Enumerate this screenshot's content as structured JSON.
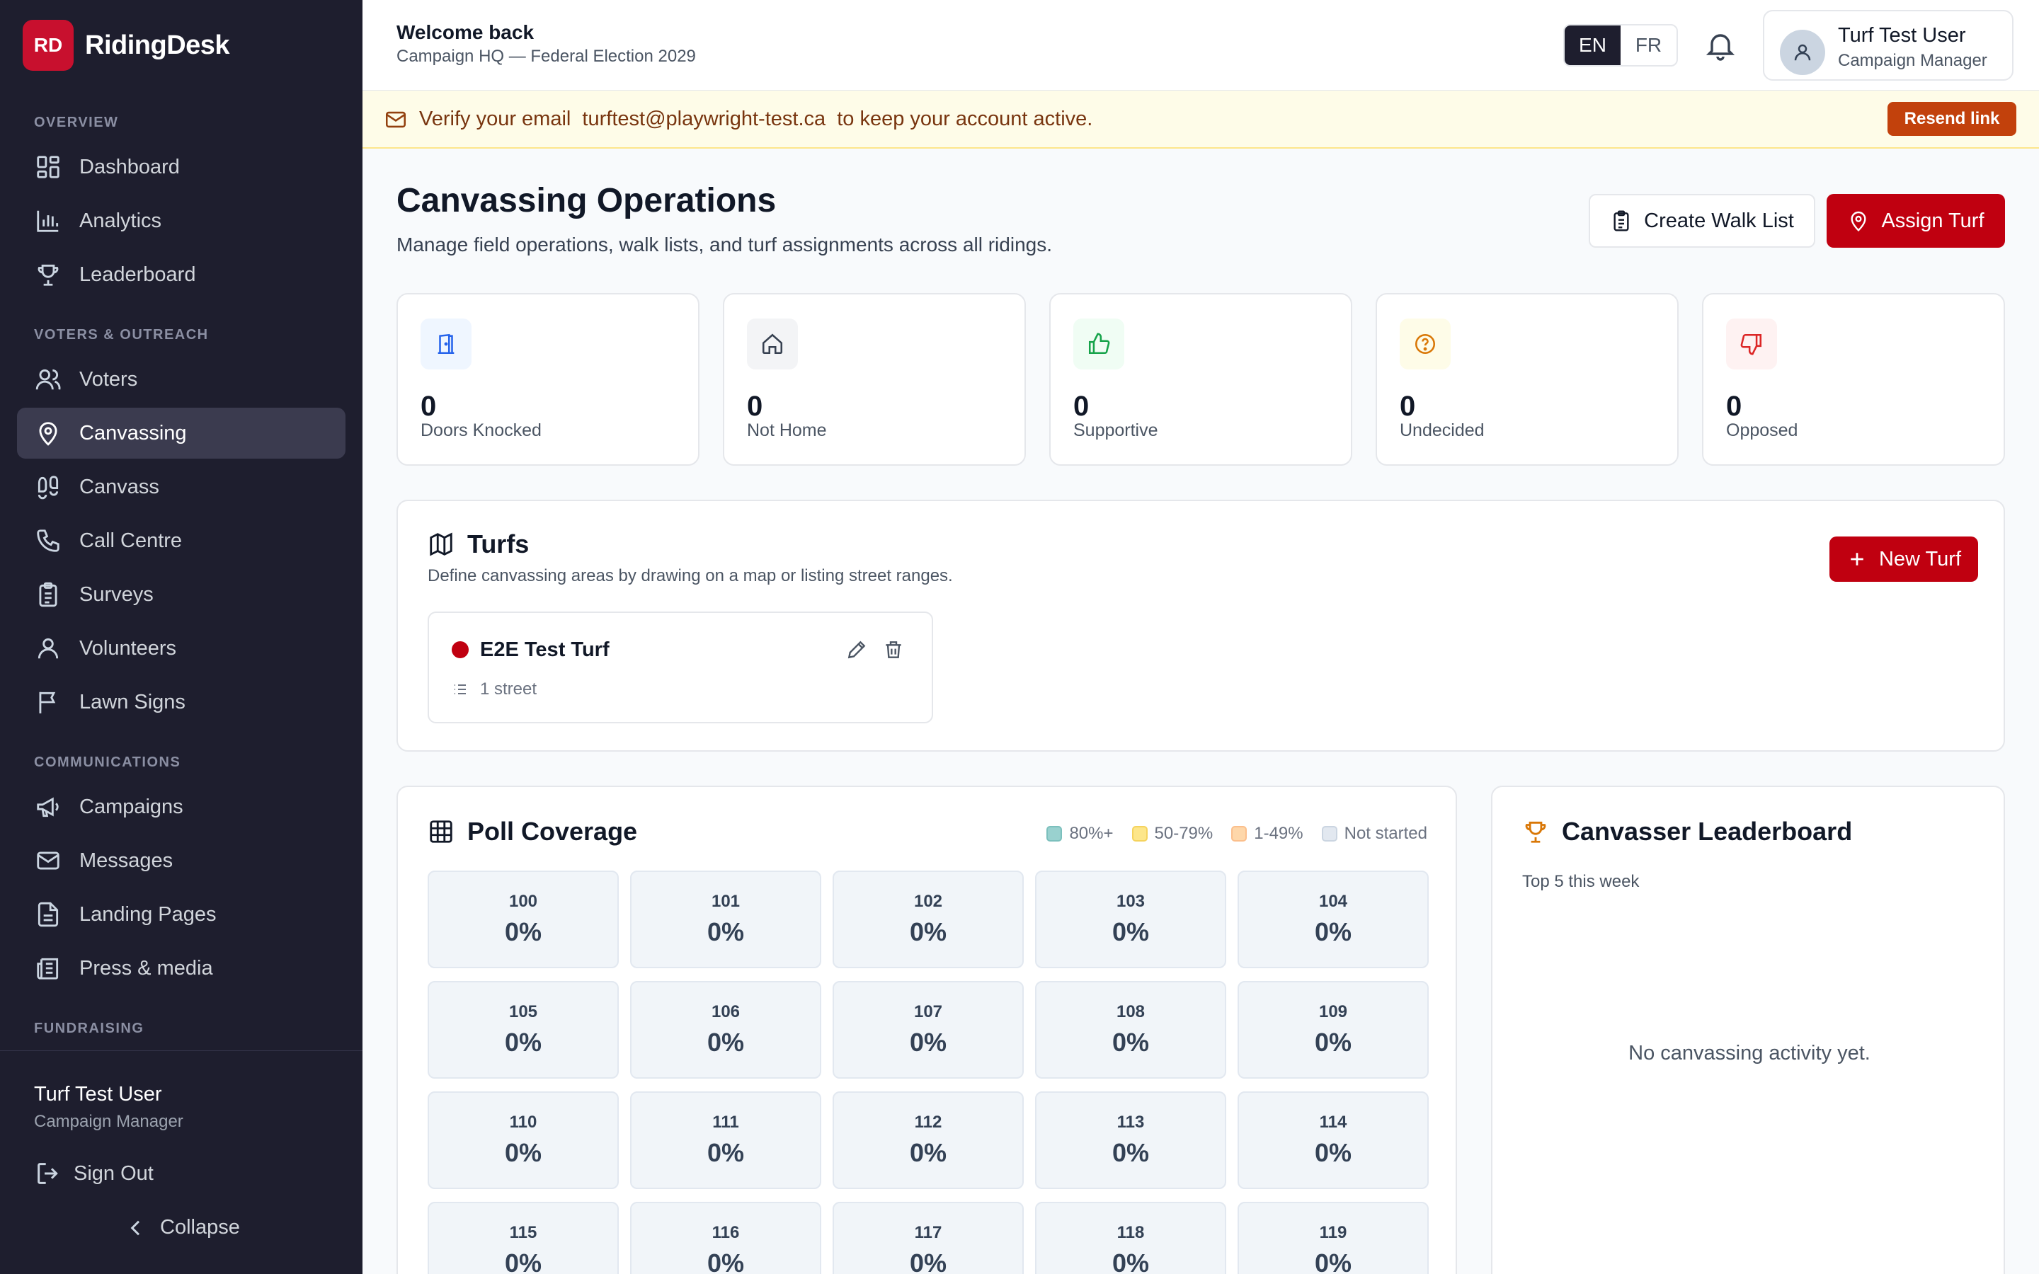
{
  "brand": {
    "logo": "RD",
    "name": "RidingDesk",
    "color": "#c8102e"
  },
  "sidebar": {
    "sections": [
      {
        "label": "OVERVIEW",
        "items": [
          {
            "label": "Dashboard",
            "icon": "dashboard-icon"
          },
          {
            "label": "Analytics",
            "icon": "analytics-icon"
          },
          {
            "label": "Leaderboard",
            "icon": "trophy-icon"
          }
        ]
      },
      {
        "label": "VOTERS & OUTREACH",
        "items": [
          {
            "label": "Voters",
            "icon": "users-icon"
          },
          {
            "label": "Canvassing",
            "icon": "map-pin-icon",
            "active": true
          },
          {
            "label": "Canvass",
            "icon": "footprints-icon"
          },
          {
            "label": "Call Centre",
            "icon": "phone-icon"
          },
          {
            "label": "Surveys",
            "icon": "clipboard-icon"
          },
          {
            "label": "Volunteers",
            "icon": "user-icon"
          },
          {
            "label": "Lawn Signs",
            "icon": "flag-icon"
          }
        ]
      },
      {
        "label": "COMMUNICATIONS",
        "items": [
          {
            "label": "Campaigns",
            "icon": "megaphone-icon"
          },
          {
            "label": "Messages",
            "icon": "mail-icon"
          },
          {
            "label": "Landing Pages",
            "icon": "file-icon"
          },
          {
            "label": "Press & media",
            "icon": "newspaper-icon"
          }
        ]
      },
      {
        "label": "FUNDRAISING",
        "items": []
      }
    ],
    "user": {
      "name": "Turf Test User",
      "role": "Campaign Manager"
    },
    "sign_out": "Sign Out",
    "collapse": "Collapse"
  },
  "header": {
    "welcome": "Welcome back",
    "subtitle": "Campaign HQ — Federal Election 2029",
    "lang": {
      "en": "EN",
      "fr": "FR",
      "selected": "EN"
    },
    "user": {
      "name": "Turf Test User",
      "role": "Campaign Manager"
    }
  },
  "banner": {
    "prefix": "Verify your email",
    "email": "turftest@playwright-test.ca",
    "suffix": "to keep your account active.",
    "button": "Resend link"
  },
  "page": {
    "title": "Canvassing Operations",
    "subtitle": "Manage field operations, walk lists, and turf assignments across all ridings.",
    "create_walk_list": "Create Walk List",
    "assign_turf": "Assign Turf"
  },
  "stats": [
    {
      "value": "0",
      "label": "Doors Knocked",
      "icon": "door-icon",
      "color": "#2563eb",
      "bg": "#eff6ff"
    },
    {
      "value": "0",
      "label": "Not Home",
      "icon": "home-icon",
      "color": "#374151",
      "bg": "#f3f4f6"
    },
    {
      "value": "0",
      "label": "Supportive",
      "icon": "thumbs-up-icon",
      "color": "#16a34a",
      "bg": "#f0fdf4"
    },
    {
      "value": "0",
      "label": "Undecided",
      "icon": "help-circle-icon",
      "color": "#d97706",
      "bg": "#fefce8"
    },
    {
      "value": "0",
      "label": "Opposed",
      "icon": "thumbs-down-icon",
      "color": "#dc2626",
      "bg": "#fef2f2"
    }
  ],
  "turfs": {
    "title": "Turfs",
    "subtitle": "Define canvassing areas by drawing on a map or listing street ranges.",
    "new_button": "New Turf",
    "items": [
      {
        "name": "E2E Test Turf",
        "streets": "1 street",
        "color": "#c00010"
      }
    ]
  },
  "poll_coverage": {
    "title": "Poll Coverage",
    "legend": [
      {
        "label": "80%+",
        "color": "#99d1cf"
      },
      {
        "label": "50-79%",
        "color": "#fde68a"
      },
      {
        "label": "1-49%",
        "color": "#fed7aa"
      },
      {
        "label": "Not started",
        "color": "#e2e8f0"
      }
    ],
    "polls": [
      {
        "id": "100",
        "pct": "0%"
      },
      {
        "id": "101",
        "pct": "0%"
      },
      {
        "id": "102",
        "pct": "0%"
      },
      {
        "id": "103",
        "pct": "0%"
      },
      {
        "id": "104",
        "pct": "0%"
      },
      {
        "id": "105",
        "pct": "0%"
      },
      {
        "id": "106",
        "pct": "0%"
      },
      {
        "id": "107",
        "pct": "0%"
      },
      {
        "id": "108",
        "pct": "0%"
      },
      {
        "id": "109",
        "pct": "0%"
      },
      {
        "id": "110",
        "pct": "0%"
      },
      {
        "id": "111",
        "pct": "0%"
      },
      {
        "id": "112",
        "pct": "0%"
      },
      {
        "id": "113",
        "pct": "0%"
      },
      {
        "id": "114",
        "pct": "0%"
      },
      {
        "id": "115",
        "pct": "0%"
      },
      {
        "id": "116",
        "pct": "0%"
      },
      {
        "id": "117",
        "pct": "0%"
      },
      {
        "id": "118",
        "pct": "0%"
      },
      {
        "id": "119",
        "pct": "0%"
      }
    ]
  },
  "leaderboard": {
    "title": "Canvasser Leaderboard",
    "subtitle": "Top 5 this week",
    "empty": "No canvassing activity yet."
  }
}
